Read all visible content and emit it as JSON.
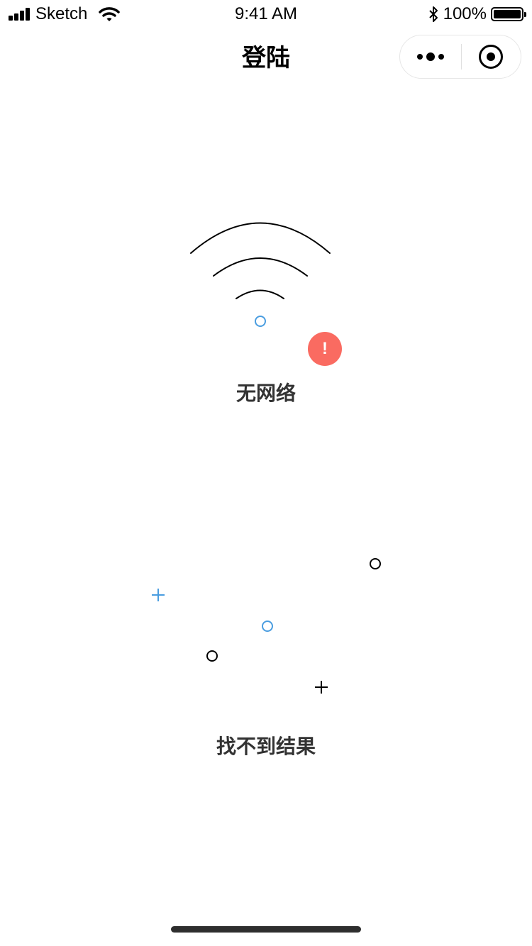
{
  "status_bar": {
    "carrier": "Sketch",
    "time": "9:41 AM",
    "battery_percent": "100%",
    "battery_level": 1.0,
    "icons": [
      "signal-icon",
      "wifi-icon",
      "bluetooth-icon",
      "battery-icon"
    ]
  },
  "nav": {
    "title": "登陆",
    "capsule": {
      "more_icon": "more-dots-icon",
      "close_icon": "record-circle-icon"
    }
  },
  "no_network": {
    "label": "无网络",
    "badge_text": "!",
    "icon": "wifi-off-icon",
    "colors": {
      "badge": "#fa6b61",
      "dot": "#4a9de0",
      "arcs": "#000000"
    }
  },
  "no_result": {
    "label": "找不到结果",
    "icon": "empty-result-icon",
    "colors": {
      "blue": "#4a9de0",
      "black": "#000000"
    }
  },
  "colors": {
    "label_text": "#333333",
    "background": "#ffffff",
    "home_indicator": "#2e2e2e"
  }
}
